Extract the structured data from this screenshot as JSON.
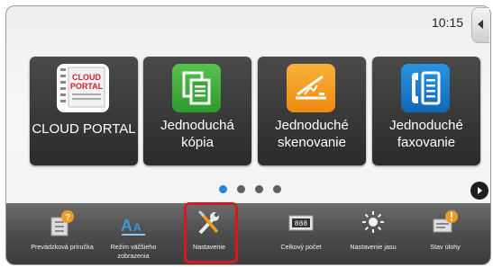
{
  "status": {
    "time": "10:15"
  },
  "apps": [
    {
      "name": "cloud-portal",
      "label": "CLOUD PORTAL"
    },
    {
      "name": "simple-copy",
      "label": "Jednoduchá kópia"
    },
    {
      "name": "simple-scan",
      "label": "Jednoduché skenovanie"
    },
    {
      "name": "simple-fax",
      "label": "Jednoduché faxovanie"
    }
  ],
  "cloud_logo_text": [
    "CLOUD",
    "PORTAL"
  ],
  "page_indicator": {
    "count": 4,
    "active": 1
  },
  "bottom_bar": [
    {
      "name": "operation-guide",
      "label": "Prevádzková príručka",
      "icon": "book-question-icon"
    },
    {
      "name": "large-display-mode",
      "label": "Režim väčšieho zobrazenia",
      "icon": "text-zoom-icon"
    },
    {
      "name": "settings",
      "label": "Nastavenie",
      "icon": "wrench-screwdriver-icon",
      "highlighted": true
    },
    {
      "name": "total-count",
      "label": "Celkový počet",
      "icon": "counter-icon"
    },
    {
      "name": "brightness",
      "label": "Nastavenie jasu",
      "icon": "brightness-icon"
    },
    {
      "name": "job-status",
      "label": "Stav úlohy",
      "icon": "job-status-icon"
    }
  ],
  "colors": {
    "accent": "#1f86e0",
    "highlight": "#d7181f",
    "copy_icon": "#3fae3a",
    "scan_icon": "#f39c1c",
    "fax_icon": "#1b7fd0"
  }
}
